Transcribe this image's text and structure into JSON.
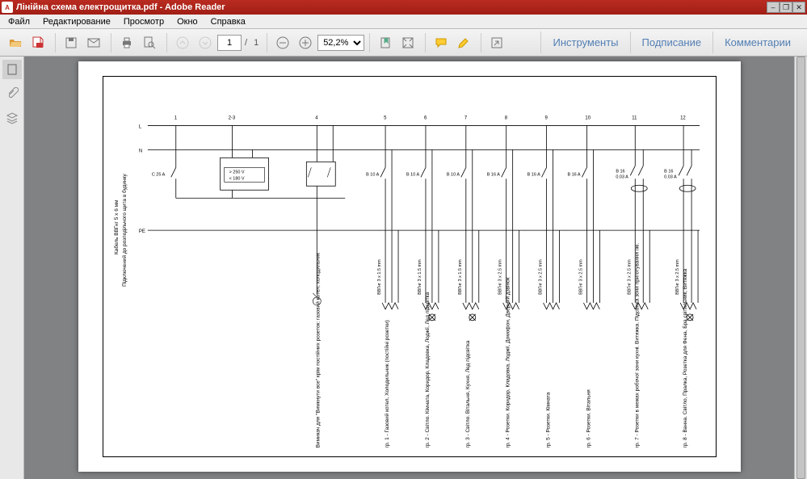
{
  "window": {
    "title": "Лінійна схема електрощитка.pdf - Adobe Reader"
  },
  "menu": {
    "file": "Файл",
    "edit": "Редактирование",
    "view": "Просмотр",
    "window": "Окно",
    "help": "Справка"
  },
  "toolbar": {
    "page_current": "1",
    "page_sep": "/",
    "page_total": "1",
    "zoom": "52,2%",
    "tabs": {
      "tools": "Инструменты",
      "sign": "Подписание",
      "comments": "Комментарии"
    }
  },
  "diagram": {
    "conductors": {
      "L": "L",
      "N": "N",
      "PE": "PE"
    },
    "side_text_1": "Кабель ВВГнг 5 x 6 мм",
    "side_text_2": "Підключений до розподільчого щита в будинку",
    "top_numbers": [
      "1",
      "2-3",
      "4",
      "5",
      "6",
      "7",
      "8",
      "9",
      "10",
      "11",
      "12"
    ],
    "main_breaker": "C 25 A",
    "relay": {
      "hi": "> 250 V",
      "lo": "< 180 V"
    },
    "breakers": {
      "b5": "B 10 A",
      "b6": "B 10 A",
      "b7": "B 10 A",
      "b8": "B 16 A",
      "b9": "B 16 A",
      "b10": "B 16 A",
      "b11_line1": "B 16",
      "b11_line2": "0.03 A",
      "b12_line1": "B 16",
      "b12_line2": "0.03 A"
    },
    "cables": {
      "c5": "ВВГнг 3 x 1.5 mm",
      "c6": "ВВГнг 3 x 1.5 mm",
      "c7": "ВВГнг 3 x 1.5 mm",
      "c8": "ВВГнг 3 x 2.5 mm",
      "c9": "ВВГнг 3 x 2.5 mm",
      "c10": "ВВГнг 3 x 2.5 mm",
      "c11": "ВВГнг 3 x 2.5 mm",
      "c12": "ВВГнг 3 x 2.5 mm"
    },
    "groups": {
      "g0": "Вимикач для \"Вимкнути все\" крім постійних розеток: газовий котел, холодильник",
      "g1": "гр. 1 - Газовий котел, Холодильник (постійні розетки)",
      "g2": "гр. 2 - Світло. Кімната, Коридор, Кладовка, Лоджії, Лед підсвітка",
      "g3": "гр. 3 - Світло. Вітальня, Кухня, Лед підсвітка",
      "g4": "гр. 4 - Розетки. Коридор, Кладовка, Лоджії, Домофон, Дверний дзвінок",
      "g5": "гр. 5 - Розетки. Кімната",
      "g6": "гр. 6 - Розетки. Вітальня",
      "g7": "гр. 7 - Розетки в межах робочої зони кухні. Витяжка. Підсвітка зони приготування їжі.",
      "g8": "гр. 8 - Ванна. Світло, Пралка, Розетка для Фена, Бра світильник, Витяжка"
    }
  }
}
